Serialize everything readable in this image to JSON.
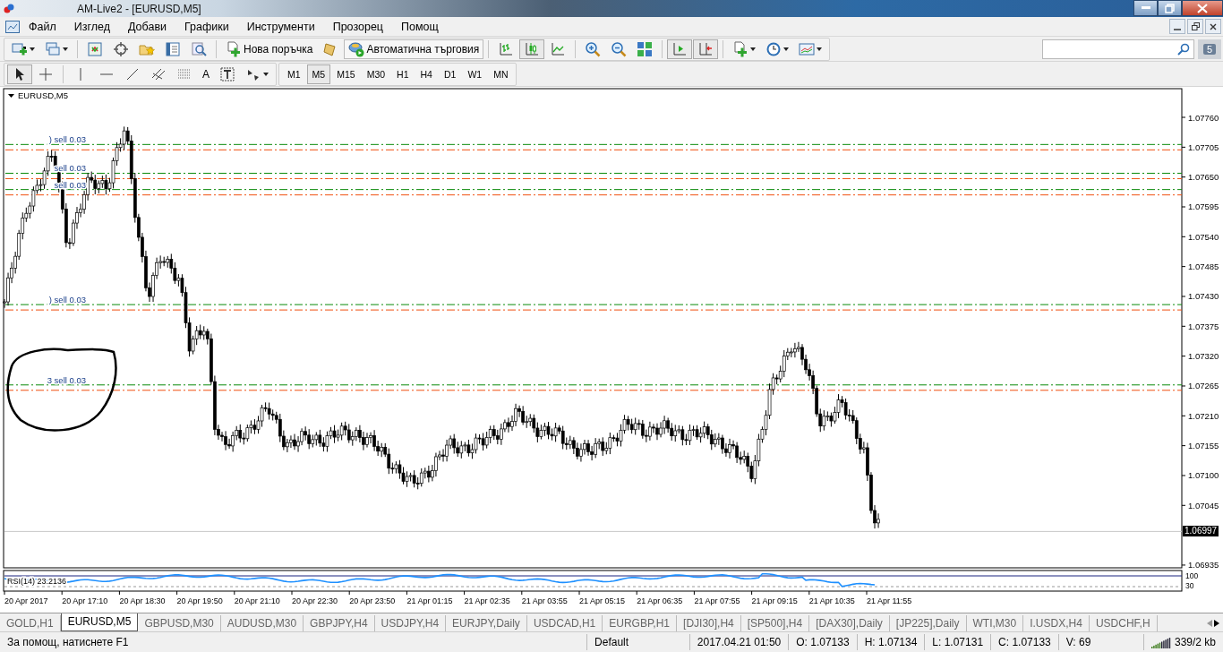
{
  "window": {
    "title": "AM-Live2 - [EURUSD,M5]"
  },
  "menu": [
    "Файл",
    "Изглед",
    "Добави",
    "Графики",
    "Инструменти",
    "Прозорец",
    "Помощ"
  ],
  "toolbar": [
    {
      "kind": "new_chart",
      "selected": false
    },
    {
      "kind": "profiles",
      "selected": false
    },
    {
      "kind": "sep"
    },
    {
      "kind": "market_watch",
      "selected": false
    },
    {
      "kind": "navigator",
      "selected": false
    },
    {
      "kind": "favorites",
      "selected": false
    },
    {
      "kind": "data_window",
      "selected": false
    },
    {
      "kind": "tester",
      "selected": false
    },
    {
      "kind": "sep"
    },
    {
      "kind": "new_order",
      "label": "Нова поръчка",
      "selected": false
    },
    {
      "kind": "editor",
      "selected": false
    },
    {
      "kind": "auto_trading",
      "label": "Автоматична търговия",
      "selected": true
    },
    {
      "kind": "sep"
    },
    {
      "kind": "bars",
      "selected": false
    },
    {
      "kind": "candles",
      "selected": true
    },
    {
      "kind": "line",
      "selected": false
    },
    {
      "kind": "sep"
    },
    {
      "kind": "zoom_in",
      "selected": false
    },
    {
      "kind": "zoom_out",
      "selected": false
    },
    {
      "kind": "tile",
      "selected": false
    },
    {
      "kind": "sep"
    },
    {
      "kind": "autoscroll",
      "selected": true
    },
    {
      "kind": "shift",
      "selected": true
    },
    {
      "kind": "sep"
    },
    {
      "kind": "indicators",
      "selected": false
    },
    {
      "kind": "periods",
      "selected": false
    },
    {
      "kind": "templates",
      "selected": false
    }
  ],
  "chat_badge": "5",
  "drawing_tools": [
    {
      "kind": "cursor",
      "selected": true
    },
    {
      "kind": "crosshair",
      "selected": false
    },
    {
      "kind": "sep"
    },
    {
      "kind": "vline",
      "selected": false
    },
    {
      "kind": "hline",
      "selected": false
    },
    {
      "kind": "trendline",
      "selected": false
    },
    {
      "kind": "channel",
      "selected": false
    },
    {
      "kind": "fibo",
      "selected": false
    },
    {
      "kind": "text",
      "label": "A",
      "selected": false
    },
    {
      "kind": "label",
      "selected": false
    },
    {
      "kind": "arrows",
      "selected": false
    }
  ],
  "timeframes": [
    {
      "label": "M1",
      "selected": false
    },
    {
      "label": "M5",
      "selected": true
    },
    {
      "label": "M15",
      "selected": false
    },
    {
      "label": "M30",
      "selected": false
    },
    {
      "label": "H1",
      "selected": false
    },
    {
      "label": "H4",
      "selected": false
    },
    {
      "label": "D1",
      "selected": false
    },
    {
      "label": "W1",
      "selected": false
    },
    {
      "label": "MN",
      "selected": false
    }
  ],
  "chart": {
    "title": "EURUSD,M5",
    "orders": [
      {
        "label": ") sell 0.03"
      },
      {
        "label": "sell 0.03"
      },
      {
        "label": "sell 0.03"
      },
      {
        "label": ") sell 0.03"
      },
      {
        "label": "3 sell 0.03"
      }
    ],
    "price_labels": [
      "1.07760",
      "1.07705",
      "1.07650",
      "1.07595",
      "1.07540",
      "1.07485",
      "1.07430",
      "1.07375",
      "1.07320",
      "1.07265",
      "1.07210",
      "1.07155",
      "1.07100",
      "1.07045",
      "1.06935"
    ],
    "current_price": "1.06997",
    "indicator": {
      "label": "RSI(14) 23.2136",
      "scale": [
        "100",
        "30"
      ]
    },
    "time_labels": [
      "20 Apr 2017",
      "20 Apr 17:10",
      "20 Apr 18:30",
      "20 Apr 19:50",
      "20 Apr 21:10",
      "20 Apr 22:30",
      "20 Apr 23:50",
      "21 Apr 01:15",
      "21 Apr 02:35",
      "21 Apr 03:55",
      "21 Apr 05:15",
      "21 Apr 06:35",
      "21 Apr 07:55",
      "21 Apr 09:15",
      "21 Apr 10:35",
      "21 Apr 11:55"
    ]
  },
  "chart_tabs": [
    {
      "label": "GOLD,H1",
      "selected": false
    },
    {
      "label": "EURUSD,M5",
      "selected": true
    },
    {
      "label": "GBPUSD,M30",
      "selected": false
    },
    {
      "label": "AUDUSD,M30",
      "selected": false
    },
    {
      "label": "GBPJPY,H4",
      "selected": false
    },
    {
      "label": "USDJPY,H4",
      "selected": false
    },
    {
      "label": "EURJPY,Daily",
      "selected": false
    },
    {
      "label": "USDCAD,H1",
      "selected": false
    },
    {
      "label": "EURGBP,H1",
      "selected": false
    },
    {
      "label": "[DJI30],H4",
      "selected": false
    },
    {
      "label": "[SP500],H4",
      "selected": false
    },
    {
      "label": "[DAX30],Daily",
      "selected": false
    },
    {
      "label": "[JP225],Daily",
      "selected": false
    },
    {
      "label": "WTI,M30",
      "selected": false
    },
    {
      "label": "I.USDX,H4",
      "selected": false
    },
    {
      "label": "USDCHF,H",
      "selected": false
    }
  ],
  "status_bar": {
    "help": "За помощ, натиснете F1",
    "profile": "Default",
    "time": "2017.04.21 01:50",
    "open": "O: 1.07133",
    "high": "H: 1.07134",
    "low": "L: 1.07131",
    "close": "C: 1.07133",
    "volume": "V: 69",
    "traffic": "339/2 kb"
  }
}
